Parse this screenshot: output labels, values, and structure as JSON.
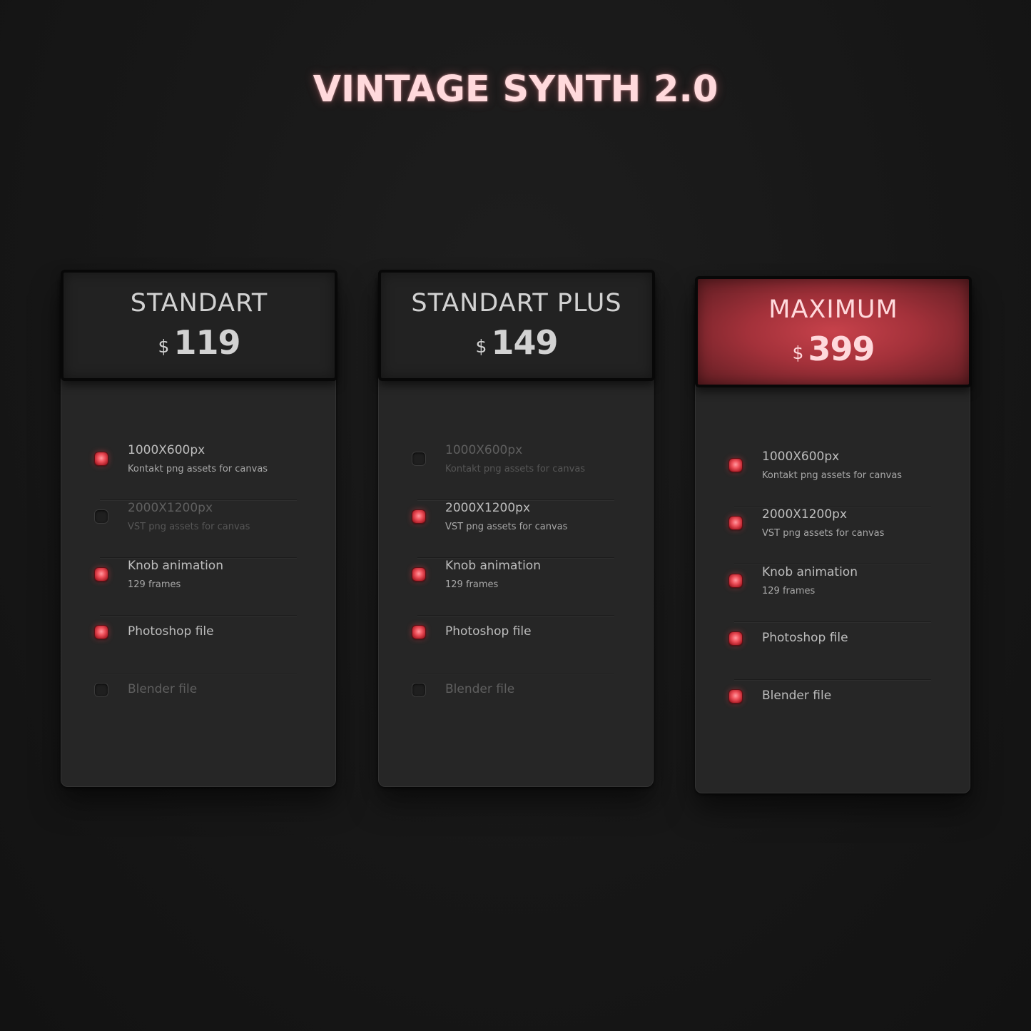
{
  "title": "VINTAGE SYNTH 2.0",
  "colors": {
    "accent": "#e0454f",
    "title_color": "#ffd9dc",
    "background": "#171717",
    "card": "#262626"
  },
  "plans": [
    {
      "name": "STANDART",
      "currency": "$",
      "price": "119",
      "features": [
        {
          "title": "1000X600px",
          "subtitle": "Kontakt png assets for canvas",
          "included": true
        },
        {
          "title": "2000X1200px",
          "subtitle": "VST png assets for canvas",
          "included": false
        },
        {
          "title": "Knob animation",
          "subtitle": "129 frames",
          "included": true
        },
        {
          "title": "Photoshop file",
          "subtitle": "",
          "included": true
        },
        {
          "title": "Blender file",
          "subtitle": "",
          "included": false
        }
      ]
    },
    {
      "name": "STANDART PLUS",
      "currency": "$",
      "price": "149",
      "features": [
        {
          "title": "1000X600px",
          "subtitle": "Kontakt png assets for canvas",
          "included": false
        },
        {
          "title": "2000X1200px",
          "subtitle": "VST png assets for canvas",
          "included": true
        },
        {
          "title": "Knob animation",
          "subtitle": "129 frames",
          "included": true
        },
        {
          "title": "Photoshop file",
          "subtitle": "",
          "included": true
        },
        {
          "title": "Blender file",
          "subtitle": "",
          "included": false
        }
      ]
    },
    {
      "name": "MAXIMUM",
      "currency": "$",
      "price": "399",
      "featured": true,
      "features": [
        {
          "title": "1000X600px",
          "subtitle": "Kontakt png assets for canvas",
          "included": true
        },
        {
          "title": "2000X1200px",
          "subtitle": "VST png assets for canvas",
          "included": true
        },
        {
          "title": "Knob animation",
          "subtitle": "129 frames",
          "included": true
        },
        {
          "title": "Photoshop file",
          "subtitle": "",
          "included": true
        },
        {
          "title": "Blender file",
          "subtitle": "",
          "included": true
        }
      ]
    }
  ]
}
